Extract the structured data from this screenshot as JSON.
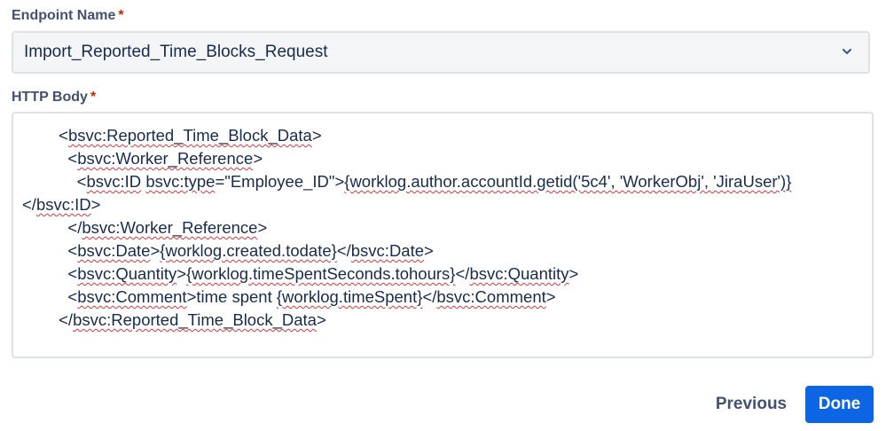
{
  "endpoint": {
    "label": "Endpoint Name",
    "required_mark": "*",
    "selected_value": "Import_Reported_Time_Blocks_Request",
    "chevron_icon": "chevron-down-icon"
  },
  "http_body": {
    "label": "HTTP Body",
    "required_mark": "*",
    "lines": [
      "        <bsvc:Reported_Time_Block_Data>",
      "          <bsvc:Worker_Reference>",
      "            <bsvc:ID bsvc:type=\"Employee_ID\">{worklog.author.accountId.getid('5c4', 'WorkerObj', 'JiraUser')}",
      "</bsvc:ID>",
      "          </bsvc:Worker_Reference>",
      "          <bsvc:Date>{worklog.created.todate}</bsvc:Date>",
      "          <bsvc:Quantity>{worklog.timeSpentSeconds.tohours}</bsvc:Quantity>",
      "          <bsvc:Comment>time spent {worklog.timeSpent}</bsvc:Comment>",
      "        </bsvc:Reported_Time_Block_Data>"
    ]
  },
  "actions": {
    "previous_label": "Previous",
    "done_label": "Done"
  },
  "colors": {
    "primary": "#0c66e4",
    "required": "#bf2600",
    "spellcheck": "#e0343c"
  }
}
